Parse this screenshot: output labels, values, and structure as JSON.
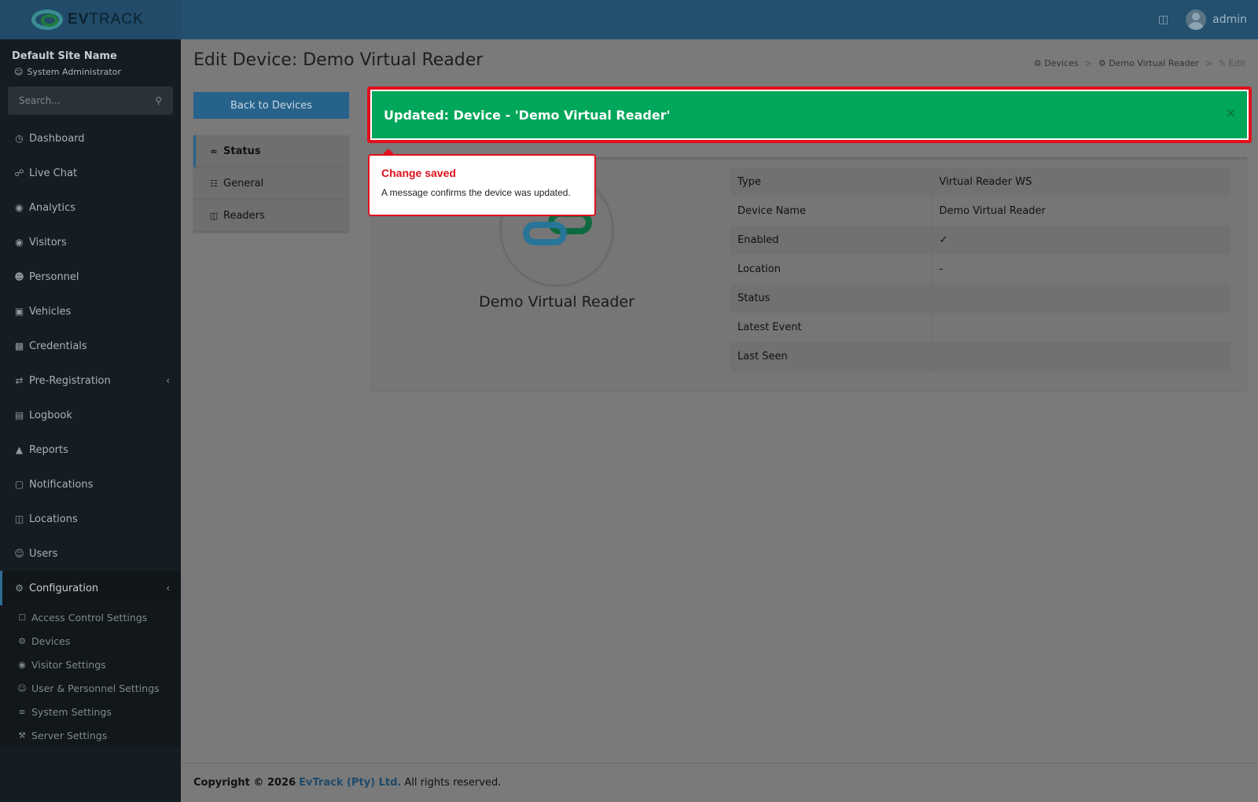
{
  "header": {
    "logo_ev": "EV",
    "logo_track": "TRACK",
    "user_name": "admin"
  },
  "sidebar": {
    "site_name": "Default Site Name",
    "role": "System Administrator",
    "search_placeholder": "Search...",
    "items": [
      {
        "label": "Dashboard",
        "icon": "dashboard-icon"
      },
      {
        "label": "Live Chat",
        "icon": "headset-icon"
      },
      {
        "label": "Analytics",
        "icon": "analytics-icon"
      },
      {
        "label": "Visitors",
        "icon": "eye-icon"
      },
      {
        "label": "Personnel",
        "icon": "personnel-icon"
      },
      {
        "label": "Vehicles",
        "icon": "car-icon"
      },
      {
        "label": "Credentials",
        "icon": "id-card-icon"
      },
      {
        "label": "Pre-Registration",
        "icon": "exchange-icon"
      },
      {
        "label": "Logbook",
        "icon": "book-icon"
      },
      {
        "label": "Reports",
        "icon": "chart-icon"
      },
      {
        "label": "Notifications",
        "icon": "comments-icon"
      },
      {
        "label": "Locations",
        "icon": "map-icon"
      },
      {
        "label": "Users",
        "icon": "users-icon"
      },
      {
        "label": "Configuration",
        "icon": "gear-icon"
      }
    ],
    "config_sub": [
      {
        "label": "Access Control Settings",
        "icon": "lock-icon"
      },
      {
        "label": "Devices",
        "icon": "gear-icon"
      },
      {
        "label": "Visitor Settings",
        "icon": "eye-icon"
      },
      {
        "label": "User & Personnel Settings",
        "icon": "users-icon"
      },
      {
        "label": "System Settings",
        "icon": "sliders-icon"
      },
      {
        "label": "Server Settings",
        "icon": "wrench-icon"
      }
    ]
  },
  "page": {
    "title": "Edit Device: Demo Virtual Reader",
    "breadcrumb": [
      "Devices",
      "Demo Virtual Reader",
      "Edit"
    ],
    "back_button": "Back to Devices",
    "tabs": [
      "Status",
      "General",
      "Readers"
    ]
  },
  "alert": {
    "message": "Updated: Device - 'Demo Virtual Reader'",
    "close": "×"
  },
  "device": {
    "name": "Demo Virtual Reader",
    "rows": [
      {
        "label": "Type",
        "value": "Virtual Reader WS"
      },
      {
        "label": "Device Name",
        "value": "Demo Virtual Reader"
      },
      {
        "label": "Enabled",
        "value": "✓"
      },
      {
        "label": "Location",
        "value": "-"
      },
      {
        "label": "Status",
        "value": ""
      },
      {
        "label": "Latest Event",
        "value": ""
      },
      {
        "label": "Last Seen",
        "value": ""
      }
    ]
  },
  "callout": {
    "title": "Change saved",
    "body": "A message confirms the device was updated."
  },
  "footer": {
    "copyright": "Copyright © 2026",
    "company": "EvTrack (Pty) Ltd.",
    "rights": "All rights reserved."
  },
  "colors": {
    "header": "#22506e",
    "sidebar": "#161d22",
    "alert_green": "#00a659",
    "highlight_red": "#e0101d",
    "primary_blue": "#27628a"
  }
}
